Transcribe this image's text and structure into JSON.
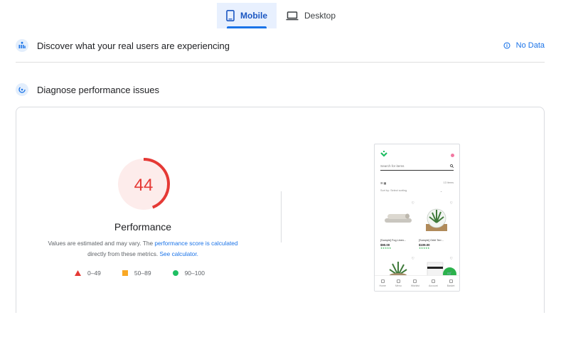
{
  "tabs": [
    {
      "label": "Mobile",
      "icon": "smartphone-icon",
      "active": true
    },
    {
      "label": "Desktop",
      "icon": "laptop-icon",
      "active": false
    }
  ],
  "field_data": {
    "title": "Discover what your real users are experiencing",
    "status": "No Data",
    "status_icon": "info-icon"
  },
  "lab": {
    "title": "Diagnose performance issues",
    "score": 44,
    "score_color": "#e53935",
    "category": "Performance",
    "desc_text_1": "Values are estimated and may vary. The ",
    "desc_link_1": "performance score is calculated",
    "desc_text_2": "directly from these metrics. ",
    "desc_link_2": "See calculator.",
    "legend": [
      {
        "range": "0–49",
        "shape": "triangle",
        "color": "#e53935"
      },
      {
        "range": "50–89",
        "shape": "square",
        "color": "#f9a825"
      },
      {
        "range": "90–100",
        "shape": "circle",
        "color": "#1fbf63"
      }
    ]
  },
  "screenshot": {
    "search_placeholder": "Search for items",
    "items_count": "13 items",
    "sort_label": "Sort by: Select sorting",
    "products": [
      {
        "name": "[Sample] Fog Linen...",
        "price": "$90.00",
        "stars": "★★★★★"
      },
      {
        "name": "[Sample] Orbit Terr...",
        "price": "$109.00",
        "stars": "★★★★★"
      }
    ],
    "nav": [
      "Home",
      "Menu",
      "Wishlist",
      "Account",
      "Basket"
    ]
  }
}
